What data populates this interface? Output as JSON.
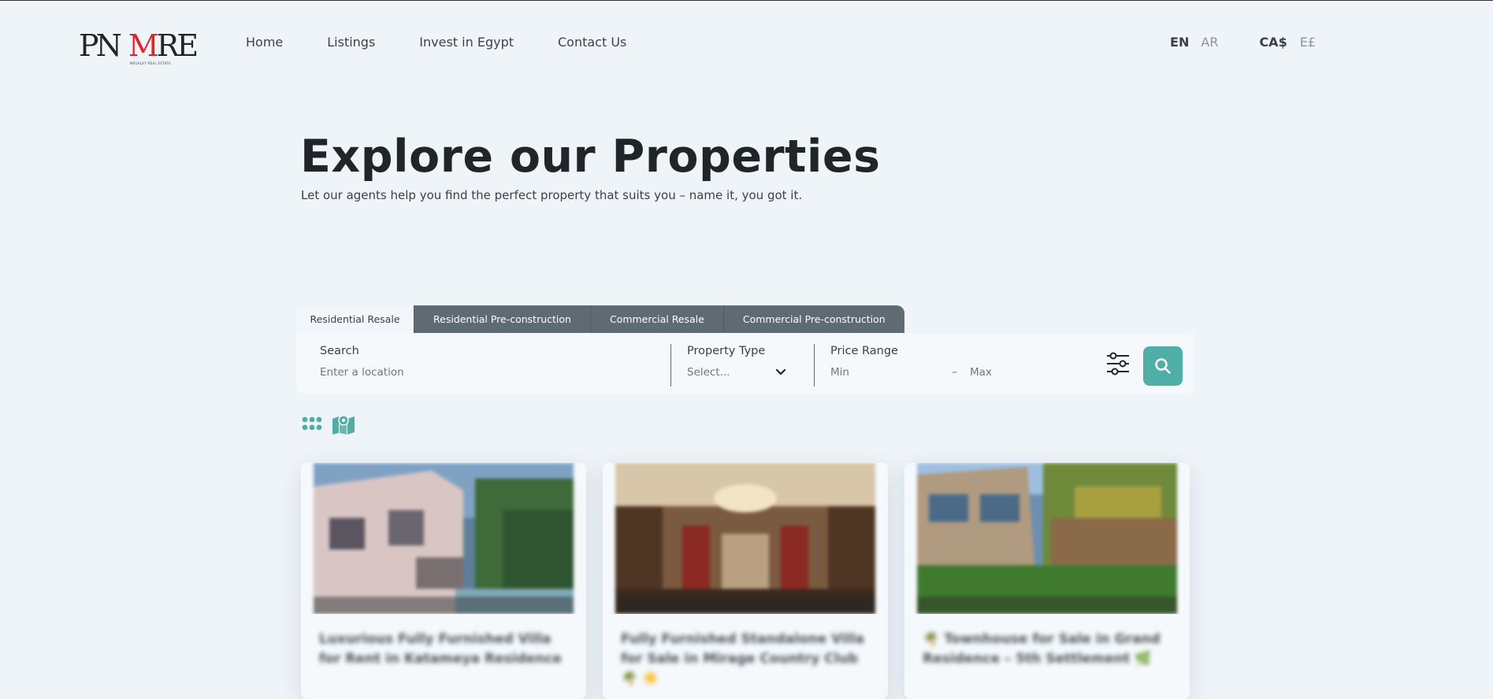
{
  "brand": {
    "logo_left": "PN",
    "logo_right_m": "M",
    "logo_right_rest": "RE",
    "logo_subtitle": "MEGALEY REAL ESTATE"
  },
  "nav": {
    "items": [
      "Home",
      "Listings",
      "Invest in Egypt",
      "Contact Us"
    ]
  },
  "language": {
    "active": "EN",
    "other": "AR"
  },
  "currency": {
    "active": "CA$",
    "other": "E£"
  },
  "hero": {
    "title": "Explore our Properties",
    "subtitle": "Let our agents help you find the perfect property that suits you – name it, you got it."
  },
  "search_tabs": [
    "Residential Resale",
    "Residential Pre-construction",
    "Commercial Resale",
    "Commercial Pre-construction"
  ],
  "search": {
    "search_label": "Search",
    "search_placeholder": "Enter a location",
    "type_label": "Property Type",
    "type_value": "Select...",
    "price_label": "Price Range",
    "min_placeholder": "Min",
    "max_placeholder": "Max",
    "dash": "–"
  },
  "colors": {
    "accent": "#4faea5",
    "tab_dark": "#5e6b73",
    "background": "#eef4f8",
    "logo_red": "#e0242b"
  },
  "icons": {
    "grid": "grid-view-icon",
    "map": "map-view-icon",
    "filter": "sliders-icon",
    "search": "magnifier-icon"
  },
  "listings": [
    {
      "title": "Luxurious Fully Furnished Villa for Rent in Katameya Residence"
    },
    {
      "title": "Fully Furnished Standalone Villa for Sale in Mirage Country Club 🌴 ☀️"
    },
    {
      "title": "🌴 Townhouse for Sale in Grand Residence – 5th Settlement 🌿"
    }
  ]
}
